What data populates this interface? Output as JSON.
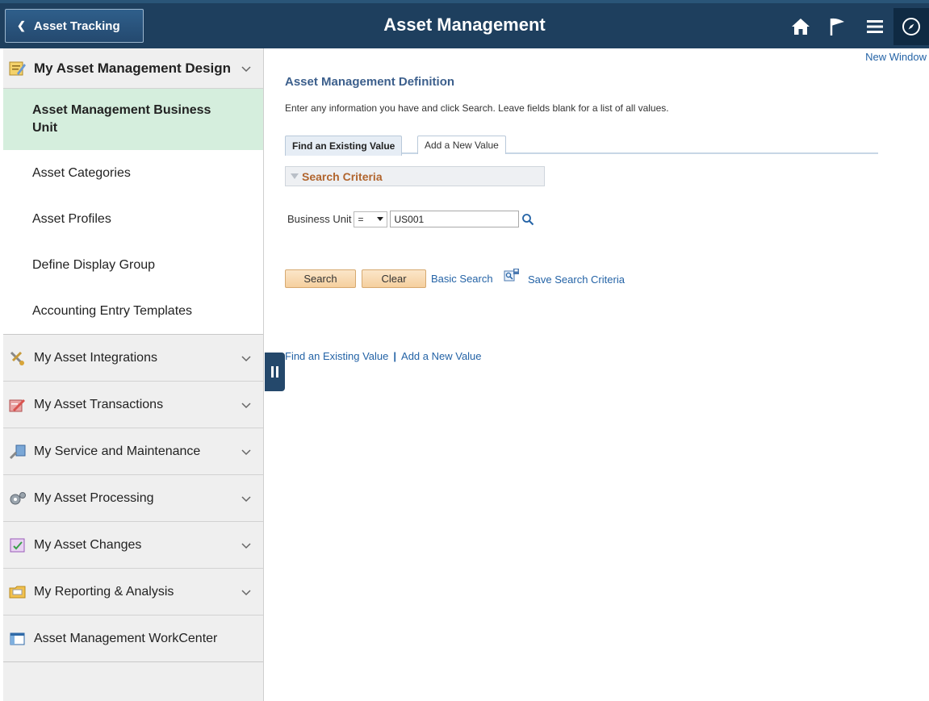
{
  "banner": {
    "back_label": "Asset Tracking",
    "title": "Asset Management",
    "icons": [
      "home-icon",
      "flag-icon",
      "menu-icon",
      "navbar-compass-icon"
    ]
  },
  "sidebar": {
    "open_group": {
      "label": "My Asset Management Design",
      "items": [
        {
          "label": "Asset Management Business Unit",
          "active": true
        },
        {
          "label": "Asset Categories",
          "active": false
        },
        {
          "label": "Asset Profiles",
          "active": false
        },
        {
          "label": "Define Display Group",
          "active": false
        },
        {
          "label": "Accounting Entry Templates",
          "active": false
        }
      ]
    },
    "groups": [
      {
        "label": "My Asset Integrations",
        "icon": "tools-icon"
      },
      {
        "label": "My Asset Transactions",
        "icon": "transaction-icon"
      },
      {
        "label": "My Service and Maintenance",
        "icon": "service-icon"
      },
      {
        "label": "My Asset Processing",
        "icon": "gears-icon"
      },
      {
        "label": "My Asset Changes",
        "icon": "changes-icon"
      },
      {
        "label": "My Reporting & Analysis",
        "icon": "folder-icon"
      }
    ],
    "workcenter_label": "Asset Management WorkCenter"
  },
  "main": {
    "new_window": "New Window",
    "title": "Asset Management Definition",
    "instructions": "Enter any information you have and click Search. Leave fields blank for a list of all values.",
    "tabs": [
      {
        "label": "Find an Existing Value",
        "active": true
      },
      {
        "label": "Add a New Value",
        "active": false
      }
    ],
    "search_criteria": {
      "title": "Search Criteria",
      "field_label": "Business Unit",
      "operator": "=",
      "value": "US001"
    },
    "buttons": {
      "search": "Search",
      "clear": "Clear",
      "basic_search": "Basic Search",
      "save_criteria": "Save Search Criteria"
    },
    "bottom_links": {
      "find": "Find an Existing Value",
      "add": "Add a New Value"
    }
  },
  "colors": {
    "banner": "#1e3f5e",
    "active_item": "#d5eedd",
    "link": "#2463a6",
    "button": "#f5cf9e"
  }
}
